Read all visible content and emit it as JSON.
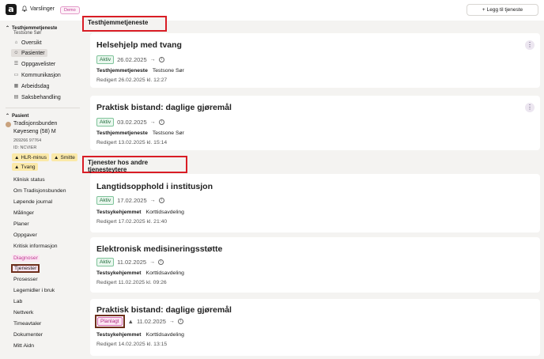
{
  "topbar": {
    "logo": "a",
    "notifications_label": "Varslinger",
    "demo_badge": "Demo",
    "add_service_label": "Legg til tjeneste"
  },
  "sidebar": {
    "unit_title": "Testhjemmetjeneste",
    "unit_sub": "Testsone Sør",
    "unit_items": [
      {
        "label": "Oversikt",
        "icon": "home-icon"
      },
      {
        "label": "Pasienter",
        "icon": "people-icon"
      },
      {
        "label": "Oppgavelister",
        "icon": "list-icon"
      },
      {
        "label": "Kommunikasjon",
        "icon": "chat-icon"
      },
      {
        "label": "Arbeidsdag",
        "icon": "calendar-icon"
      },
      {
        "label": "Saksbehandling",
        "icon": "folder-icon"
      }
    ],
    "patient_section": "Pasient",
    "patient_name_1": "Tradisjonsbunden",
    "patient_name_2": "Køyeseng (58) M",
    "patient_ssn": "269266 97764",
    "patient_id": "ID: NCVIER",
    "warnings": [
      "HLR-minus",
      "Smitte",
      "Tvang"
    ],
    "links": [
      "Klinisk status",
      "Om Tradisjonsbunden",
      "Løpende journal",
      "Målinger",
      "Planer",
      "Oppgaver",
      "Kritisk informasjon",
      "Diagnoser",
      "Tjenester",
      "Prosesser",
      "Legemidler i bruk",
      "Lab",
      "Nettverk",
      "Timeavtaler",
      "Dokumenter",
      "Mitt Aidn"
    ]
  },
  "main": {
    "group1_title": "Testhjemmetjeneste",
    "group2_title": "Tjenester hos andre tjenesteytere",
    "cards": [
      {
        "title": "Helsehjelp med tvang",
        "status": "Aktiv",
        "date": "26.02.2025",
        "org": "Testhjemmetjeneste",
        "unit": "Testsone Sør",
        "edited": "Redigert 26.02.2025 kl. 12:27"
      },
      {
        "title": "Praktisk bistand: daglige gjøremål",
        "status": "Aktiv",
        "date": "03.02.2025",
        "org": "Testhjemmetjeneste",
        "unit": "Testsone Sør",
        "edited": "Redigert 13.02.2025 kl. 15:14"
      },
      {
        "title": "Langtidsopphold i institusjon",
        "status": "Aktiv",
        "date": "17.02.2025",
        "org": "Testsykehjemmet",
        "unit": "Korttidsavdeling",
        "edited": "Redigert 17.02.2025 kl. 21:40"
      },
      {
        "title": "Elektronisk medisineringsstøtte",
        "status": "Aktiv",
        "date": "11.02.2025",
        "org": "Testsykehjemmet",
        "unit": "Korttidsavdeling",
        "edited": "Redigert 11.02.2025 kl. 09:26"
      },
      {
        "title": "Praktisk bistand: daglige gjøremål",
        "status": "Planlagt",
        "date": "11.02.2025",
        "org": "Testsykehjemmet",
        "unit": "Korttidsavdeling",
        "edited": "Redigert 14.02.2025 kl. 13:15"
      }
    ]
  }
}
